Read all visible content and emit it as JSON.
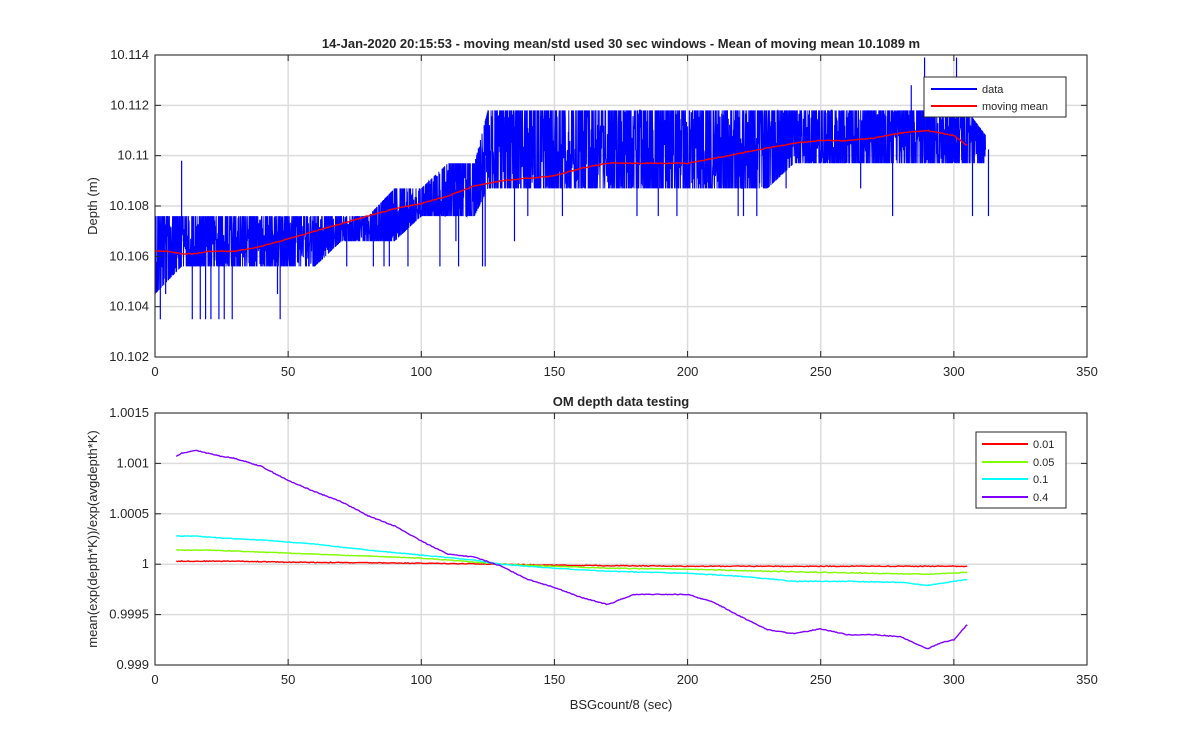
{
  "chart_data": [
    {
      "type": "line",
      "title": "14-Jan-2020 20:15:53 - moving mean/std used 30 sec windows - Mean of moving mean 10.1089 m",
      "xlabel": "",
      "ylabel": "Depth (m)",
      "xlim": [
        0,
        350
      ],
      "ylim": [
        10.102,
        10.114
      ],
      "xticks": [
        "0",
        "50",
        "100",
        "150",
        "200",
        "250",
        "300",
        "350"
      ],
      "yticks": [
        "10.102",
        "10.104",
        "10.106",
        "10.108",
        "10.11",
        "10.112",
        "10.114"
      ],
      "grid": true,
      "legend_position": "top-right",
      "series": [
        {
          "name": "data",
          "color": "#0000ff",
          "style": "noisy-band",
          "x": [
            0,
            10,
            20,
            25,
            30,
            40,
            50,
            60,
            70,
            80,
            90,
            100,
            110,
            120,
            125,
            140,
            150,
            160,
            170,
            180,
            190,
            200,
            210,
            220,
            230,
            240,
            250,
            260,
            270,
            280,
            290,
            300,
            305,
            312
          ],
          "lower": [
            10.1045,
            10.1056,
            10.1056,
            10.1056,
            10.1056,
            10.1056,
            10.1056,
            10.1056,
            10.1066,
            10.1066,
            10.1066,
            10.1076,
            10.1076,
            10.1076,
            10.1087,
            10.1087,
            10.1087,
            10.1087,
            10.1087,
            10.1087,
            10.1087,
            10.1087,
            10.1087,
            10.1087,
            10.1087,
            10.1097,
            10.1097,
            10.1097,
            10.1097,
            10.1097,
            10.1097,
            10.1097,
            10.1097,
            10.1097
          ],
          "upper": [
            10.1076,
            10.1076,
            10.1076,
            10.1076,
            10.1076,
            10.1076,
            10.1076,
            10.1076,
            10.1076,
            10.1076,
            10.1087,
            10.1087,
            10.1097,
            10.1097,
            10.1118,
            10.1118,
            10.1118,
            10.1118,
            10.1118,
            10.1118,
            10.1118,
            10.1118,
            10.1118,
            10.1118,
            10.1118,
            10.1118,
            10.1118,
            10.1118,
            10.1118,
            10.1118,
            10.1118,
            10.1118,
            10.1118,
            10.1108
          ],
          "spikes": [
            [
              2,
              10.1035
            ],
            [
              4,
              10.1045
            ],
            [
              10,
              10.1098
            ],
            [
              14,
              10.1035
            ],
            [
              17,
              10.1035
            ],
            [
              19,
              10.1035
            ],
            [
              21,
              10.1035
            ],
            [
              24,
              10.1035
            ],
            [
              26,
              10.1035
            ],
            [
              29,
              10.1035
            ],
            [
              46,
              10.1045
            ],
            [
              47,
              10.1035
            ],
            [
              60,
              10.1056
            ],
            [
              72,
              10.1056
            ],
            [
              82,
              10.1056
            ],
            [
              86,
              10.1056
            ],
            [
              88,
              10.1056
            ],
            [
              95,
              10.1056
            ],
            [
              107,
              10.1056
            ],
            [
              113,
              10.1066
            ],
            [
              114,
              10.1056
            ],
            [
              123,
              10.1056
            ],
            [
              124,
              10.1056
            ],
            [
              135,
              10.1066
            ],
            [
              140,
              10.1076
            ],
            [
              153,
              10.1076
            ],
            [
              181,
              10.1076
            ],
            [
              189,
              10.1076
            ],
            [
              196,
              10.1076
            ],
            [
              219,
              10.1076
            ],
            [
              221,
              10.1076
            ],
            [
              226,
              10.1076
            ],
            [
              237,
              10.1087
            ],
            [
              265,
              10.1087
            ],
            [
              277,
              10.1076
            ],
            [
              284,
              10.1128
            ],
            [
              289,
              10.1139
            ],
            [
              301,
              10.1139
            ],
            [
              307,
              10.1076
            ],
            [
              313,
              10.1076
            ]
          ]
        },
        {
          "name": "moving mean",
          "color": "#ff0000",
          "style": "line",
          "x": [
            0,
            5,
            10,
            15,
            20,
            30,
            40,
            50,
            60,
            70,
            80,
            90,
            100,
            110,
            120,
            130,
            140,
            150,
            160,
            170,
            180,
            190,
            200,
            210,
            220,
            230,
            240,
            250,
            260,
            270,
            280,
            290,
            300,
            305
          ],
          "y": [
            10.1062,
            10.1062,
            10.1061,
            10.1061,
            10.1062,
            10.1062,
            10.1064,
            10.1067,
            10.107,
            10.1073,
            10.1076,
            10.1079,
            10.1081,
            10.1084,
            10.1088,
            10.109,
            10.1091,
            10.1092,
            10.1095,
            10.1097,
            10.1097,
            10.1097,
            10.1097,
            10.1099,
            10.1101,
            10.1103,
            10.1105,
            10.1106,
            10.1106,
            10.1107,
            10.1109,
            10.111,
            10.1108,
            10.1104
          ]
        }
      ]
    },
    {
      "type": "line",
      "title": "OM depth data testing",
      "xlabel": "BSGcount/8 (sec)",
      "ylabel": "mean(exp(depth*K))/exp(avgdepth*K)",
      "xlim": [
        0,
        350
      ],
      "ylim": [
        0.999,
        1.0015
      ],
      "xticks": [
        "0",
        "50",
        "100",
        "150",
        "200",
        "250",
        "300",
        "350"
      ],
      "yticks": [
        "0.999",
        "0.9995",
        "1",
        "1.0005",
        "1.001",
        "1.0015"
      ],
      "grid": true,
      "legend_position": "top-right",
      "series": [
        {
          "name": "0.01",
          "color": "#ff0000",
          "x": [
            8,
            30,
            50,
            100,
            130,
            150,
            200,
            250,
            290,
            305
          ],
          "y": [
            1.00003,
            1.00003,
            1.00002,
            1.00001,
            1.0,
            0.99999,
            0.99998,
            0.99998,
            0.99998,
            0.99998
          ]
        },
        {
          "name": "0.05",
          "color": "#80ff00",
          "x": [
            8,
            20,
            30,
            50,
            70,
            100,
            120,
            130,
            150,
            170,
            200,
            230,
            250,
            270,
            290,
            305
          ],
          "y": [
            1.00014,
            1.00014,
            1.00013,
            1.00011,
            1.00009,
            1.00006,
            1.00002,
            1.0,
            0.99998,
            0.99996,
            0.99995,
            0.99993,
            0.99992,
            0.99991,
            0.9999,
            0.99992
          ]
        },
        {
          "name": "0.1",
          "color": "#00ffff",
          "x": [
            8,
            15,
            25,
            40,
            60,
            80,
            100,
            120,
            130,
            150,
            170,
            200,
            220,
            240,
            260,
            280,
            290,
            300,
            305
          ],
          "y": [
            1.00028,
            1.00028,
            1.00026,
            1.00024,
            1.0002,
            1.00014,
            1.00009,
            1.00004,
            1.0,
            0.99996,
            0.99993,
            0.99991,
            0.99988,
            0.99983,
            0.99983,
            0.99982,
            0.99979,
            0.99983,
            0.99985
          ]
        },
        {
          "name": "0.4",
          "color": "#8000ff",
          "x": [
            8,
            10,
            15,
            20,
            25,
            30,
            40,
            50,
            60,
            70,
            80,
            90,
            100,
            110,
            120,
            130,
            140,
            150,
            160,
            170,
            180,
            190,
            200,
            210,
            220,
            230,
            240,
            250,
            260,
            270,
            280,
            290,
            295,
            300,
            305
          ],
          "y": [
            1.00107,
            1.0011,
            1.00113,
            1.0011,
            1.00107,
            1.00105,
            1.00097,
            1.00083,
            1.00072,
            1.00062,
            1.00048,
            1.00038,
            1.00023,
            1.0001,
            1.00007,
            0.99998,
            0.99985,
            0.99977,
            0.99967,
            0.9996,
            0.9997,
            0.9997,
            0.9997,
            0.99962,
            0.99948,
            0.99935,
            0.99931,
            0.99936,
            0.9993,
            0.9993,
            0.99928,
            0.99916,
            0.99922,
            0.99925,
            0.9994
          ]
        }
      ]
    }
  ]
}
